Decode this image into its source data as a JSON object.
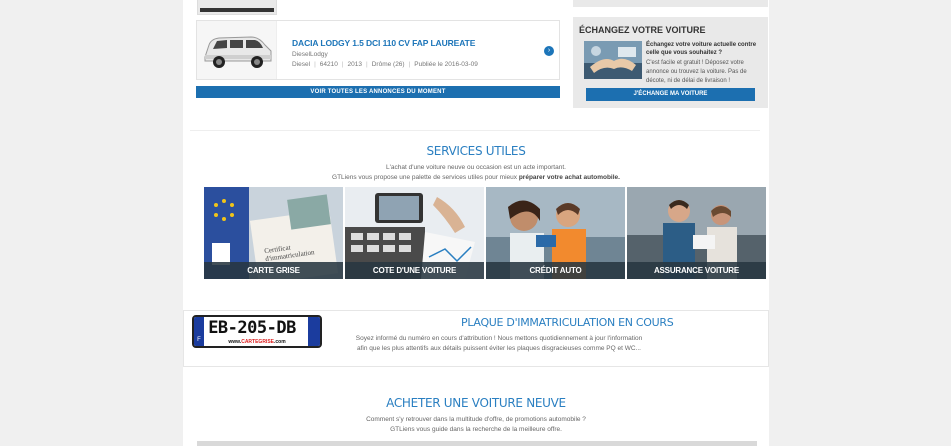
{
  "listing": {
    "title": "DACIA LODGY 1.5 DCI 110 CV FAP LAUREATE",
    "subtitle": "DieselLodgy",
    "fuel": "Diesel",
    "km": "64210",
    "year": "2013",
    "location": "Drôme (26)",
    "published": "Publiée le 2016-03-09",
    "go_icon": "›"
  },
  "all_listings_button": "VOIR TOUTES LES ANNONCES DU MOMENT",
  "exchange": {
    "heading": "ÉCHANGEZ VOTRE VOITURE",
    "question": "Échangez votre voiture actuelle contre celle que vous souhaitez ?",
    "description": "C'est facile et gratuit ! Déposez votre annonce ou trouvez la voiture. Pas de décote, ni de délai de livraison !",
    "button": "J'ÉCHANGE MA VOITURE"
  },
  "services": {
    "title": "SERVICES UTILES",
    "line1": "L'achat d'une voiture neuve ou occasion est un acte important.",
    "line2_prefix": "GTLiens vous propose une palette de services utiles pour mieux ",
    "line2_bold": "préparer votre achat automobile.",
    "tiles": [
      {
        "label": "CARTE GRISE"
      },
      {
        "label": "COTE D'UNE VOITURE"
      },
      {
        "label": "CRÉDIT AUTO"
      },
      {
        "label": "ASSURANCE VOITURE"
      }
    ]
  },
  "plate": {
    "registration": "EB-205-DB",
    "country": "F",
    "website_prefix": "www.",
    "website_brand": "CARTEGRISE",
    "website_suffix": ".com",
    "title": "PLAQUE D'IMMATRICULATION EN COURS",
    "line1": "Soyez informé du numéro en cours d'attribution ! Nous mettons quotidiennement à jour l'information",
    "line2": "afin que les plus attentifs aux détails puissent éviter les plaques disgracieuses comme PQ et WC..."
  },
  "buy": {
    "title": "ACHETER UNE VOITURE NEUVE",
    "line1": "Comment s'y retrouver dans la multitude d'offre, de promotions automobile ?",
    "line2": "GTLiens vous guide dans la recherche de la meilleure offre."
  }
}
